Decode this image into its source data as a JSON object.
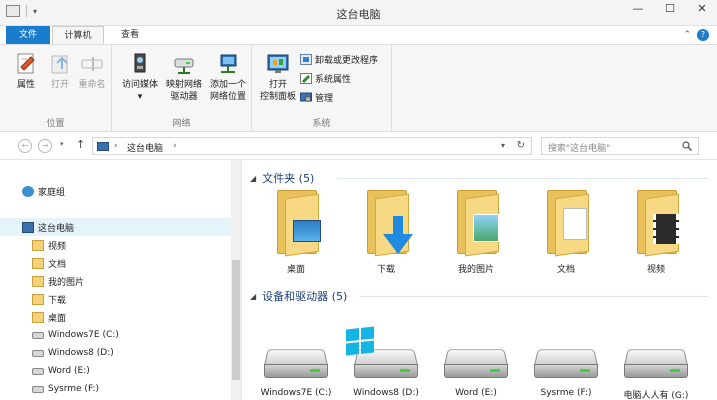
{
  "window": {
    "title": "这台电脑",
    "min": "—",
    "max": "☐",
    "close": "✕"
  },
  "tabs": {
    "file": "文件",
    "computer": "计算机",
    "view": "查看"
  },
  "ribbon": {
    "groups": {
      "location": "位置",
      "network": "网络",
      "system": "系统"
    },
    "buttons": {
      "properties": "属性",
      "open": "打开",
      "rename": "重命名",
      "access_media_1": "访问媒体",
      "map_drive_1": "映射网络",
      "map_drive_2": "驱动器",
      "add_location_1": "添加一个",
      "add_location_2": "网络位置",
      "control_panel_1": "打开",
      "control_panel_2": "控制面板",
      "uninstall": "卸载或更改程序",
      "system_props": "系统属性",
      "manage": "管理"
    }
  },
  "address": {
    "breadcrumb": "这台电脑",
    "search_placeholder": "搜索\"这台电脑\""
  },
  "nav": {
    "homegroup": "家庭组",
    "thispc": "这台电脑",
    "items": [
      "视频",
      "文档",
      "我的图片",
      "下载",
      "桌面"
    ],
    "drives": [
      "Windows7E (C:)",
      "Windows8 (D:)",
      "Word (E:)",
      "Sysrme (F:)"
    ]
  },
  "content": {
    "folders_header": "文件夹 (5)",
    "folders": [
      "桌面",
      "下载",
      "我的图片",
      "文档",
      "视频"
    ],
    "drives_header": "设备和驱动器 (5)",
    "drives": [
      "Windows7E (C:)",
      "Windows8 (D:)",
      "Word (E:)",
      "Sysrme (F:)",
      "电脑人人有 (G:)"
    ]
  },
  "colors": {
    "accent": "#1a7ccc",
    "folder": "#f7d984",
    "win_logo": "#14b5e4"
  }
}
